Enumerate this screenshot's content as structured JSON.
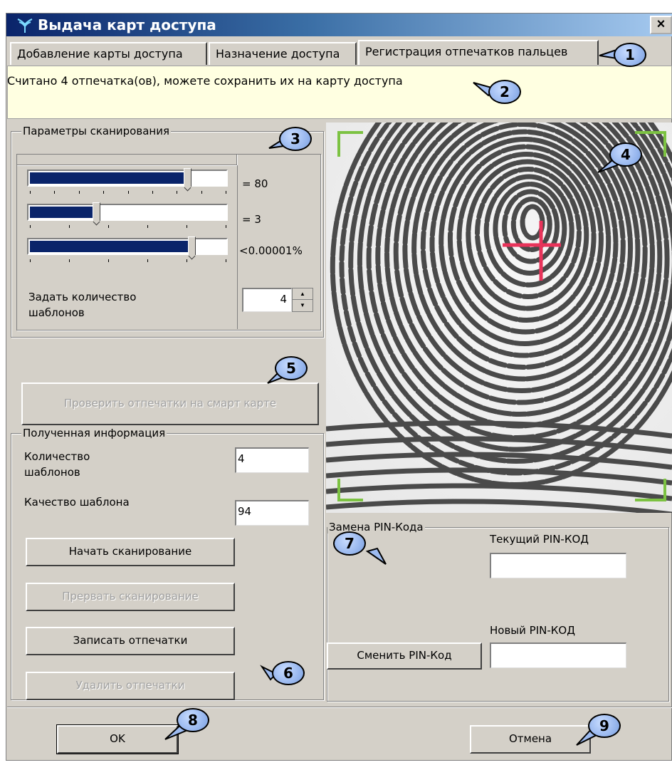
{
  "window": {
    "title": "Выдача карт доступа",
    "close_glyph": "×"
  },
  "tabs": [
    {
      "label": "Добавление карты доступа",
      "active": false
    },
    {
      "label": "Назначение доступа",
      "active": false
    },
    {
      "label": "Регистрация отпечатков пальцев",
      "active": true
    }
  ],
  "status_message": "Считано 4 отпечатка(ов), можете сохранить их на карту доступа",
  "scan_params": {
    "title": "Параметры сканирования",
    "sliders": [
      {
        "value_label": "= 80",
        "fill_fraction": 0.8
      },
      {
        "value_label": "= 3",
        "fill_fraction": 0.3
      },
      {
        "value_label": "<0.00001%",
        "fill_fraction": 0.83
      }
    ],
    "template_count_label": "Задать количество шаблонов",
    "template_count_value": "4"
  },
  "verify_button": "Проверить отпечатки на смарт карте",
  "received_info": {
    "title": "Полученная информация",
    "templates_count_label": "Количество шаблонов",
    "templates_count_value": "4",
    "template_quality_label": "Качество шаблона",
    "template_quality_value": "94"
  },
  "actions": {
    "start_scan": "Начать сканирование",
    "abort_scan": "Прервать сканирование",
    "write_prints": "Записать отпечатки",
    "delete_prints": "Удалить отпечатки"
  },
  "pin": {
    "title": "Замена PIN-Кода",
    "current_label": "Текущий PIN-КОД",
    "current_value": "",
    "new_label": "Новый PIN-КОД",
    "new_value": "",
    "change_button": "Сменить PIN-Код"
  },
  "footer": {
    "ok": "OK",
    "cancel": "Отмена"
  },
  "callouts": [
    "1",
    "2",
    "3",
    "4",
    "5",
    "6",
    "7",
    "8",
    "9"
  ],
  "colors": {
    "title_gradient_start": "#0a246a",
    "title_gradient_end": "#a6caf0",
    "info_background": "#ffffe1",
    "slider_fill": "#0a246a",
    "callout_fill": "#9dbbf0",
    "crosshair": "#e8335a",
    "corner_marks": "#7cc242"
  },
  "icons": {
    "app": "fingerprint-reader-icon",
    "close": "close-icon",
    "spinner": "spin-arrows-icon"
  }
}
